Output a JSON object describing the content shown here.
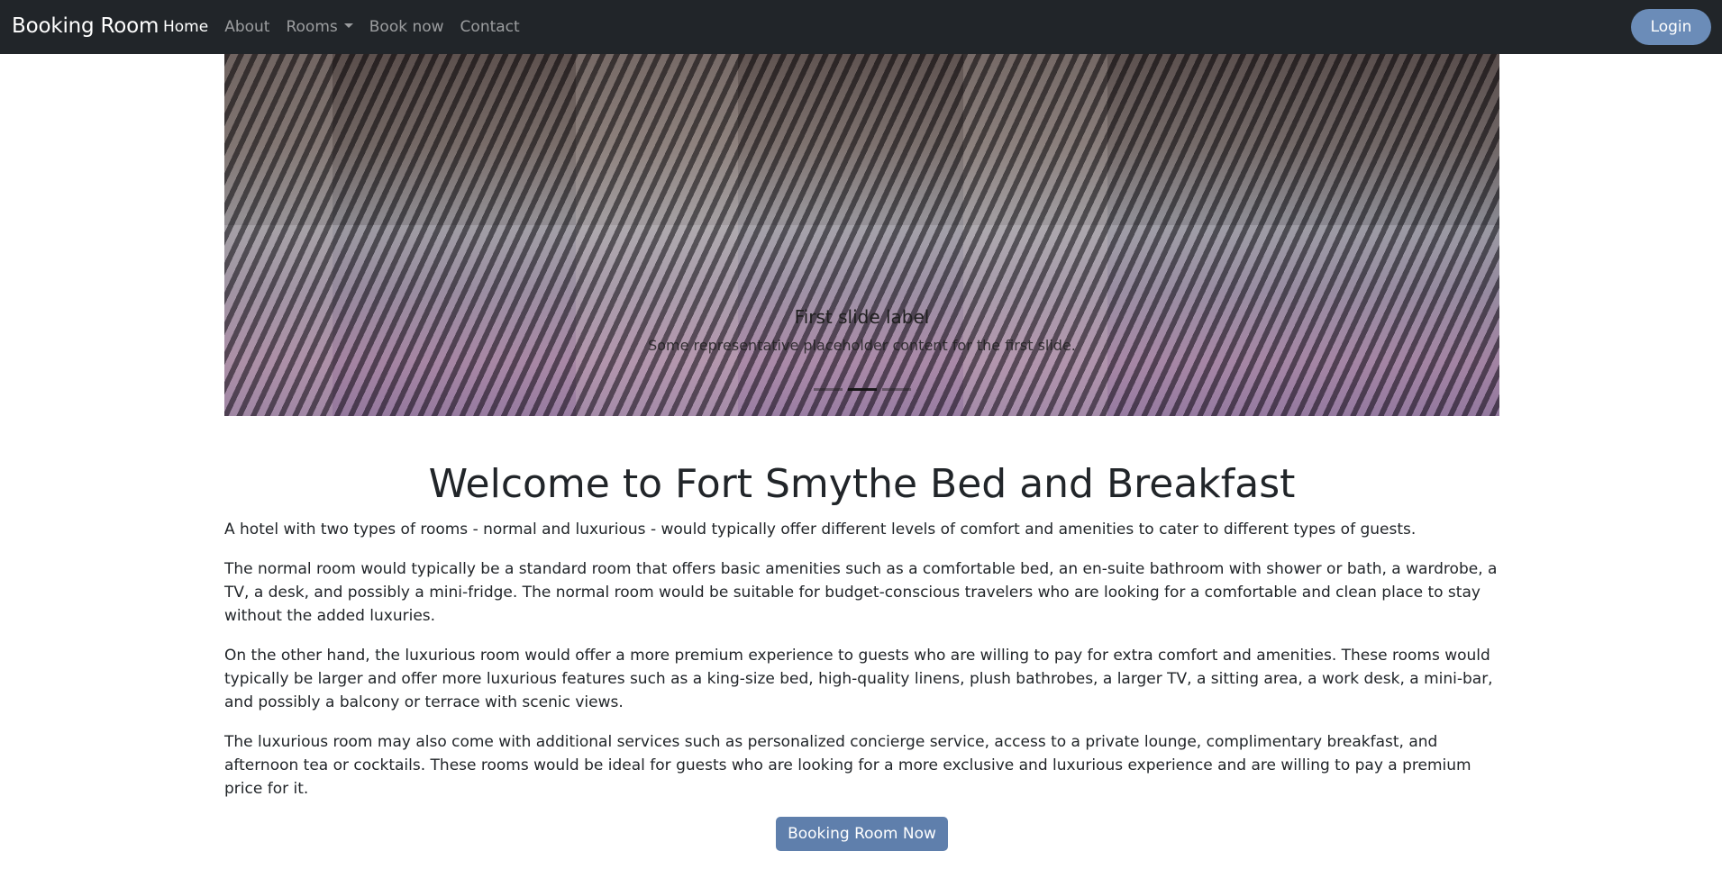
{
  "navbar": {
    "brand": "Booking Room",
    "links": [
      {
        "label": "Home",
        "active": true
      },
      {
        "label": "About",
        "active": false
      },
      {
        "label": "Rooms",
        "active": false,
        "dropdown": true
      },
      {
        "label": "Book now",
        "active": false
      },
      {
        "label": "Contact",
        "active": false
      }
    ],
    "login_label": "Login"
  },
  "carousel": {
    "caption_title": "First slide label",
    "caption_text": "Some representative placeholder content for the first slide.",
    "indicators": 3,
    "active_index": 1
  },
  "main": {
    "heading": "Welcome to Fort Smythe Bed and Breakfast",
    "paragraphs": [
      "A hotel with two types of rooms - normal and luxurious - would typically offer different levels of comfort and amenities to cater to different types of guests.",
      "The normal room would typically be a standard room that offers basic amenities such as a comfortable bed, an en-suite bathroom with shower or bath, a wardrobe, a TV, a desk, and possibly a mini-fridge. The normal room would be suitable for budget-conscious travelers who are looking for a comfortable and clean place to stay without the added luxuries.",
      "On the other hand, the luxurious room would offer a more premium experience to guests who are willing to pay for extra comfort and amenities. These rooms would typically be larger and offer more luxurious features such as a king-size bed, high-quality linens, plush bathrobes, a larger TV, a sitting area, a work desk, a mini-bar, and possibly a balcony or terrace with scenic views.",
      "The luxurious room may also come with additional services such as personalized concierge service, access to a private lounge, complimentary breakfast, and afternoon tea or cocktails. These rooms would be ideal for guests who are looking for a more exclusive and luxurious experience and are willing to pay a premium price for it."
    ],
    "cta_label": "Booking Room Now"
  },
  "colors": {
    "navbar_bg": "#212529",
    "login_bg": "#6b8cb8",
    "cta_bg": "#5f7fac"
  }
}
